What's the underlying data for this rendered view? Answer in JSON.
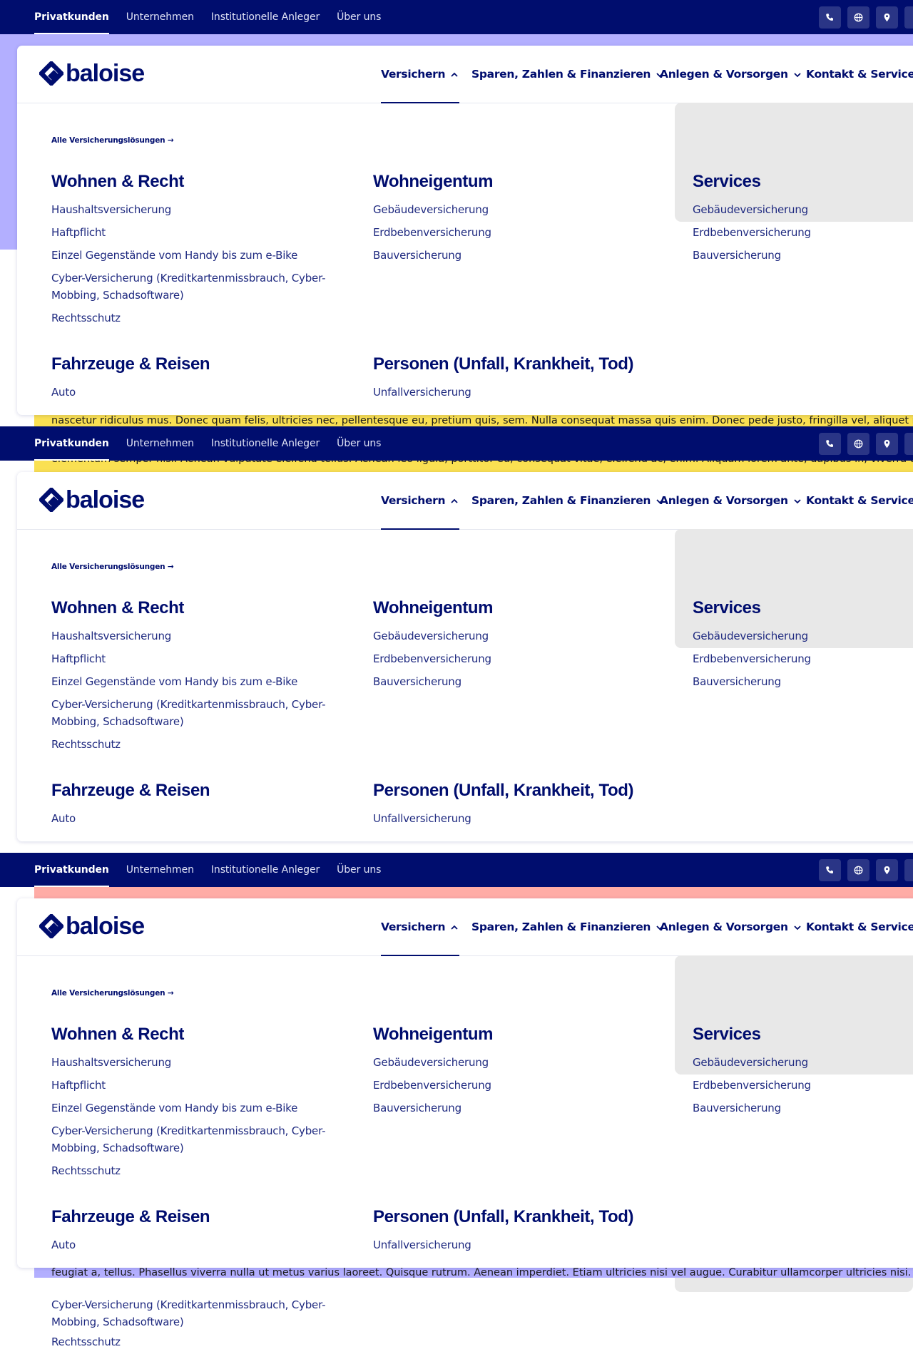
{
  "topbar": {
    "links": [
      "Privatkunden",
      "Unternehmen",
      "Institutionelle Anleger",
      "Über uns"
    ],
    "active": "Privatkunden",
    "icons": [
      "phone-icon",
      "globe-icon",
      "location-pin-icon"
    ]
  },
  "header": {
    "logo_text": "baloise",
    "nav": {
      "versichern": "Versichern",
      "sparen": "Sparen, Zahlen & Finanzieren",
      "anlegen": "Anlegen & Vorsorgen",
      "kontakt": "Kontakt & Services"
    }
  },
  "menu": {
    "all_link": "Alle Versicherungslösungen →",
    "wohnen": {
      "title": "Wohnen & Recht",
      "items": [
        "Haushaltsversicherung",
        "Haftpflicht",
        "Einzel Gegenstände vom Handy bis zum e-Bike",
        "Cyber-Versicherung (Kreditkartenmissbrauch, Cyber-Mobbing, Schadsoftware)",
        "Rechtsschutz"
      ]
    },
    "wohneigentum": {
      "title": "Wohneigentum",
      "items": [
        "Gebäudeversicherung",
        "Erdbebenversicherung",
        "Bauversicherung"
      ]
    },
    "services": {
      "title": "Services",
      "items": [
        "Gebäudeversicherung",
        "Erdbebenversicherung",
        "Bauversicherung"
      ]
    },
    "fahrzeuge": {
      "title": "Fahrzeuge & Reisen",
      "items": [
        "Auto"
      ]
    },
    "personen": {
      "title": "Personen (Unfall, Krankheit, Tod)",
      "items": [
        "Unfallversicherung"
      ]
    }
  },
  "background": {
    "lorem_yellow_1": "nascetur ridiculus mus. Donec quam felis, ultricies nec, pellentesque eu, pretium quis, sem. Nulla consequat massa quis enim. Donec pede justo, fringilla vel, aliquet nec, vulputate eget, arcu.",
    "lorem_yellow_2": "elementum semper nisi. Aenean vulputate eleifend tellus. Aenean leo ligula, porttitor eu, consequat vitae, eleifend ac, enim. Aliquam lorem ante, dapibus in, viverra quis, feugiat a, tellus.",
    "lorem_yellow_3": "feugiat a, tellus. Phasellus viverra nulla ut metus varius laoreet. Quisque rutrum. Aenean imperdiet. Etiam ultricies nisi vel augue. Curabitur ullamcorper ultricies nisi.",
    "lorem_purple": "feugiat a, tellus. Phasellus viverra nulla ut metus varius laoreet. Quisque rutrum. Aenean imperdiet. Etiam ultricies nisi vel augue. Curabitur ullamcorper ultricies nisi.",
    "colors": {
      "lavender": "#b3afff",
      "yellow": "#fae052",
      "salmon": "#ffaca6",
      "navy": "#000d6e"
    }
  }
}
